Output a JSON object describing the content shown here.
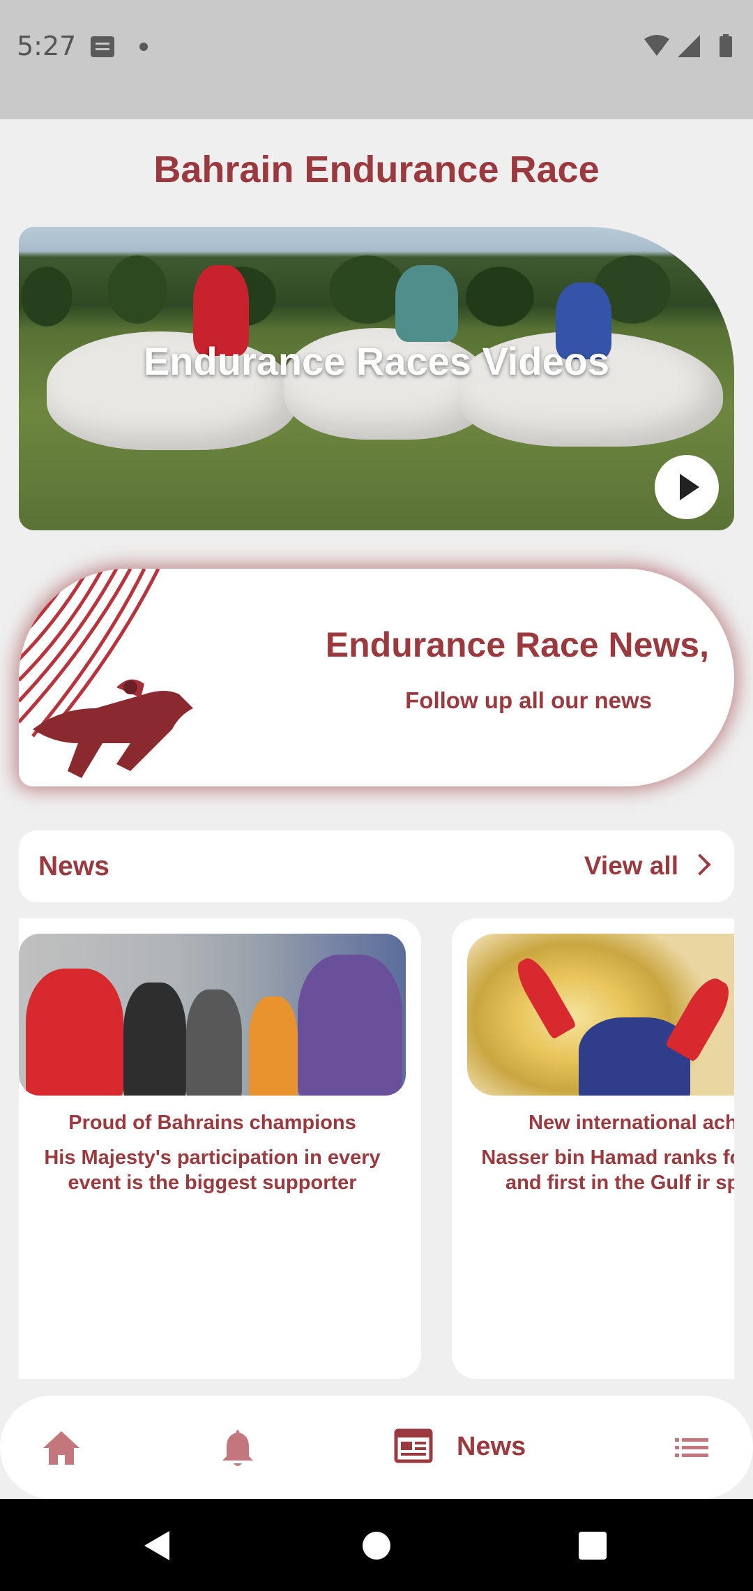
{
  "status_bar": {
    "time": "5:27"
  },
  "header": {
    "title": "Bahrain Endurance Race"
  },
  "video_card": {
    "title": "Endurance Races Videos"
  },
  "news_banner": {
    "title": "Endurance Race News,",
    "subtitle": "Follow up all our news"
  },
  "news_section": {
    "label": "News",
    "view_all": "View all"
  },
  "news_cards": [
    {
      "title": "Proud of Bahrains champions",
      "description": "His Majesty's participation in every event is the biggest supporter"
    },
    {
      "title": "New international achie",
      "description": "Nasser bin Hamad ranks fo world and first in the Gulf ir sports"
    }
  ],
  "bottom_nav": {
    "active_label": "News"
  },
  "colors": {
    "brand": "#9b3a3e",
    "background": "#efefef"
  }
}
